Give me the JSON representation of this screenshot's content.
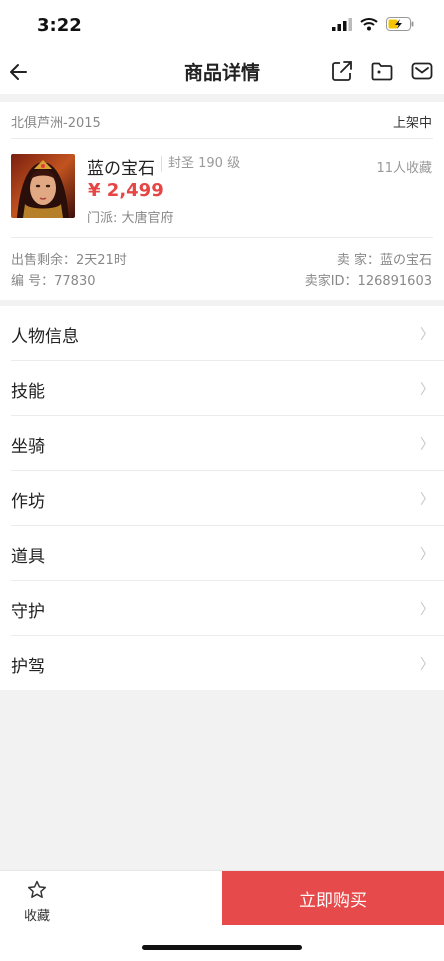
{
  "status_bar": {
    "time": "3:22"
  },
  "nav": {
    "title": "商品详情"
  },
  "item": {
    "server": "北俱芦洲-2015",
    "listing_status": "上架中",
    "name": "蓝の宝石",
    "level": "封圣 190 级",
    "favorites": "11人收藏",
    "price": "¥ 2,499",
    "sect": "门派: 大唐官府",
    "remaining": "出售剩余：2天21时",
    "number": "编 号：77830",
    "seller": "卖 家：蓝の宝石",
    "seller_id": "卖家ID：126891603"
  },
  "menu": [
    {
      "label": "人物信息"
    },
    {
      "label": "技能"
    },
    {
      "label": "坐骑"
    },
    {
      "label": "作坊"
    },
    {
      "label": "道具"
    },
    {
      "label": "守护"
    },
    {
      "label": "护驾"
    }
  ],
  "chevron": "〉",
  "bottom": {
    "favorite_label": "收藏",
    "buy_label": "立即购买"
  },
  "colors": {
    "accent": "#e64a4a",
    "price": "#e64545"
  }
}
